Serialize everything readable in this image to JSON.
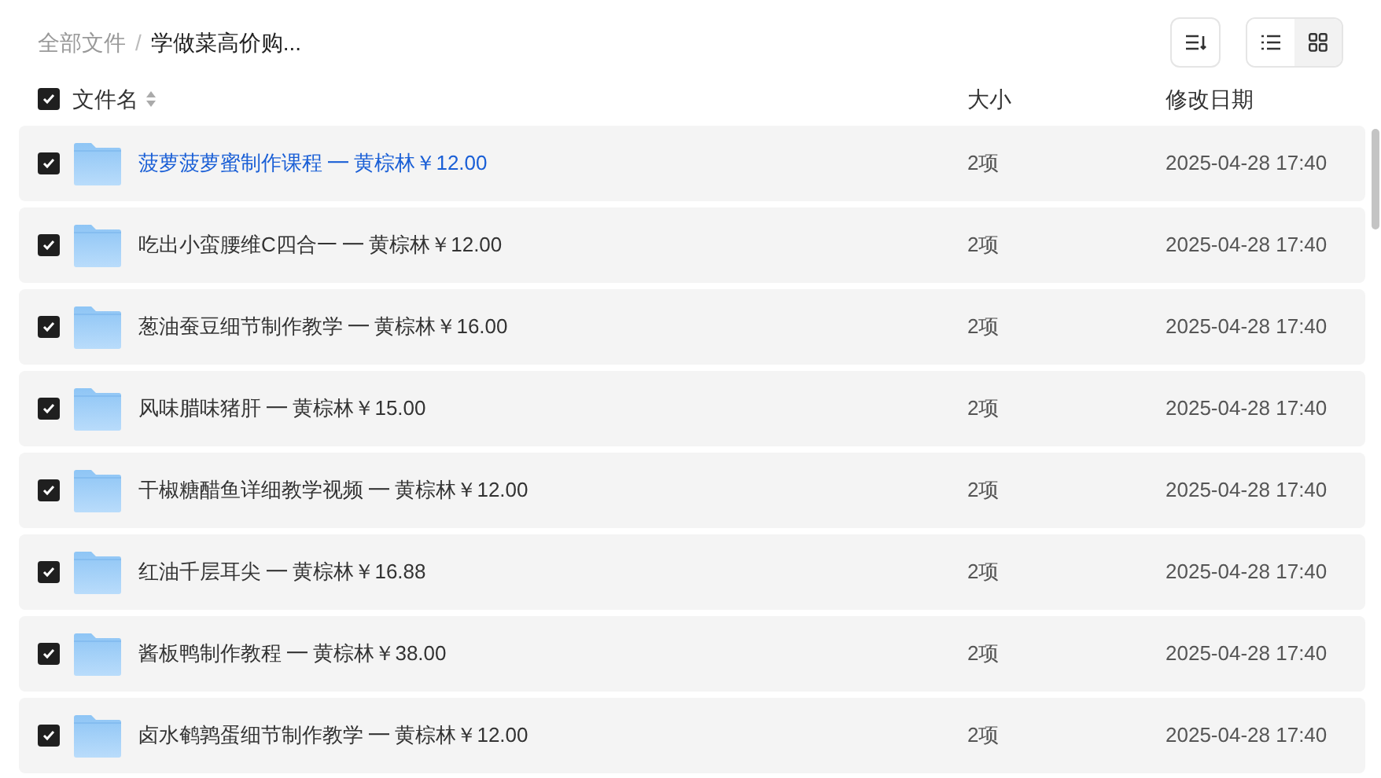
{
  "breadcrumb": [
    {
      "label": "全部文件",
      "current": false
    },
    {
      "label": "学做菜高价购...",
      "current": true
    }
  ],
  "breadcrumb_separator": "/",
  "view_toggle": [
    {
      "kind": "list",
      "selected": true
    },
    {
      "kind": "grid",
      "selected": false
    }
  ],
  "table": {
    "select_all": {
      "checked": true
    },
    "columns": [
      "文件名",
      "大小",
      "修改日期"
    ],
    "rows": [
      {
        "name": "菠萝菠萝蜜制作课程 ━ 黄棕林￥12.00",
        "size": "2项",
        "modified": "2025-04-28 17:40",
        "checked": true,
        "highlighted": true
      },
      {
        "name": "吃出小蛮腰维C四合一 ━ 黄棕林￥12.00",
        "size": "2项",
        "modified": "2025-04-28 17:40",
        "checked": true,
        "highlighted": false
      },
      {
        "name": "葱油蚕豆细节制作教学 ━ 黄棕林￥16.00",
        "size": "2项",
        "modified": "2025-04-28 17:40",
        "checked": true,
        "highlighted": false
      },
      {
        "name": "风味腊味猪肝 ━ 黄棕林￥15.00",
        "size": "2项",
        "modified": "2025-04-28 17:40",
        "checked": true,
        "highlighted": false
      },
      {
        "name": "干椒糖醋鱼详细教学视频 ━ 黄棕林￥12.00",
        "size": "2项",
        "modified": "2025-04-28 17:40",
        "checked": true,
        "highlighted": false
      },
      {
        "name": "红油千层耳尖 ━ 黄棕林￥16.88",
        "size": "2项",
        "modified": "2025-04-28 17:40",
        "checked": true,
        "highlighted": false
      },
      {
        "name": "酱板鸭制作教程 ━ 黄棕林￥38.00",
        "size": "2项",
        "modified": "2025-04-28 17:40",
        "checked": true,
        "highlighted": false
      },
      {
        "name": "卤水鹌鹑蛋细节制作教学 ━ 黄棕林￥12.00",
        "size": "2项",
        "modified": "2025-04-28 17:40",
        "checked": true,
        "highlighted": false
      }
    ]
  }
}
